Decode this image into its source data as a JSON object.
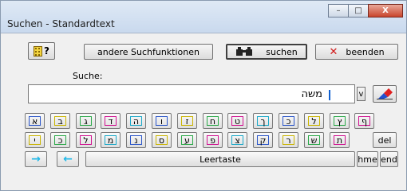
{
  "window": {
    "title": "Suchen - Standardtext",
    "minimize": "–",
    "maximize": "□",
    "close": "X"
  },
  "toolbar": {
    "help_label": "?",
    "other_functions": "andere Suchfunktionen",
    "search": "suchen",
    "end": "beenden"
  },
  "search": {
    "label": "Suche:",
    "value": "משה",
    "dropdown": "v"
  },
  "keyboard": {
    "row1": [
      "א",
      "ב",
      "ג",
      "ד",
      "ה",
      "ו",
      "ז",
      "ח",
      "ט",
      "ך",
      "כ",
      "ל",
      "ץ",
      "ף"
    ],
    "row2": [
      "י",
      "כ",
      "ל",
      "מ",
      "נ",
      "ס",
      "ע",
      "פ",
      "צ",
      "ק",
      "ר",
      "ש",
      "ת"
    ],
    "row1_colors": [
      "#2a55c8",
      "#c9b400",
      "#2aa848",
      "#d01090",
      "#1aa8c8",
      "#2a55c8",
      "#c9b400",
      "#2aa848",
      "#d01090",
      "#1aa8c8",
      "#2a55c8",
      "#c9b400",
      "#2aa848",
      "#d01090"
    ],
    "row2_colors": [
      "#c9b400",
      "#2aa848",
      "#d01090",
      "#1aa8c8",
      "#2a55c8",
      "#c9b400",
      "#2aa848",
      "#d01090",
      "#1aa8c8",
      "#2a55c8",
      "#c9b400",
      "#2aa848",
      "#d01090"
    ],
    "del": "del",
    "arrow_right": "→",
    "arrow_left": "←",
    "space": "Leertaste",
    "hme": "hme",
    "end": "end"
  }
}
